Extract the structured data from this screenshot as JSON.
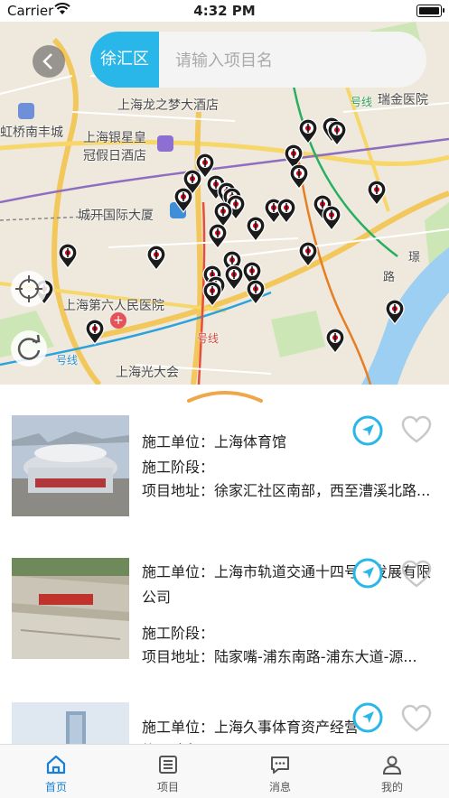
{
  "status_bar": {
    "carrier": "Carrier",
    "time": "4:32 PM"
  },
  "map": {
    "labels": [
      "上海龙之梦大酒店",
      "上海银星皇",
      "冠假日酒店",
      "城开国际大厦",
      "上海第六人民医院",
      "上海光大会",
      "瑞金医院",
      "虹桥南丰城",
      "号线",
      "号线",
      "号线",
      "路",
      "璟"
    ],
    "accent": "#29b6e8"
  },
  "search": {
    "district": "徐汇区",
    "placeholder": "请输入项目名"
  },
  "list": {
    "field_labels": {
      "unit": "施工单位：",
      "stage": "施工阶段：",
      "address": "项目地址："
    },
    "items": [
      {
        "unit": "上海体育馆",
        "stage": "",
        "address": "徐家汇社区南部，西至漕溪北路..."
      },
      {
        "unit": "上海市轨道交通十四号线发展有限公司",
        "stage": "",
        "address": "陆家嘴-浦东南路-浦东大道-源..."
      },
      {
        "unit": "上海久事体育资产经营",
        "stage": "",
        "address": ""
      }
    ]
  },
  "tabs": [
    {
      "label": "首页",
      "icon": "home-icon",
      "active": true
    },
    {
      "label": "项目",
      "icon": "list-icon",
      "active": false
    },
    {
      "label": "消息",
      "icon": "message-icon",
      "active": false
    },
    {
      "label": "我的",
      "icon": "user-icon",
      "active": false
    }
  ]
}
